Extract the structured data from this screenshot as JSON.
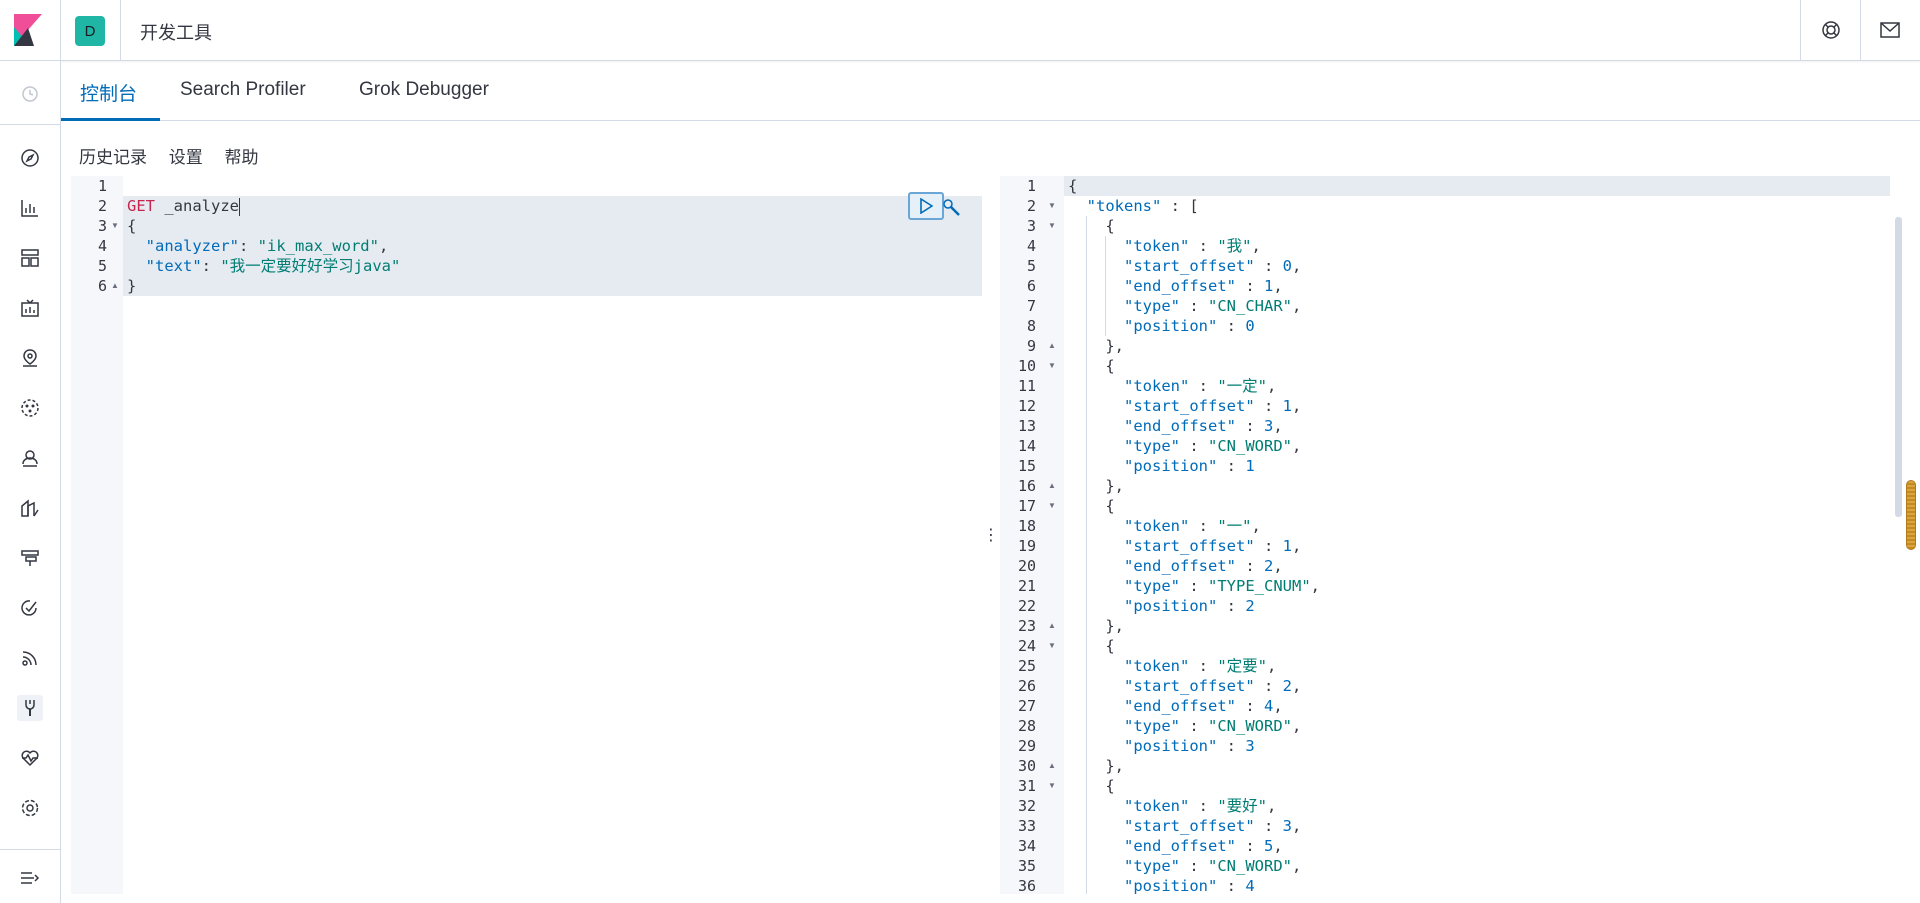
{
  "header": {
    "space_initial": "D",
    "app_title": "开发工具",
    "icons": [
      "kibana-logo-icon",
      "help-icon",
      "mail-icon"
    ]
  },
  "sidenav": {
    "icons": [
      "recent-icon",
      "discover-icon",
      "visualize-icon",
      "dashboard-icon",
      "canvas-icon",
      "maps-icon",
      "ml-icon",
      "infrastructure-icon",
      "logs-icon",
      "apm-icon",
      "uptime-icon",
      "siem-icon",
      "devtools-icon",
      "monitoring-icon",
      "management-icon",
      "collapse-icon"
    ]
  },
  "tabs": [
    {
      "label": "控制台",
      "active": true
    },
    {
      "label": "Search Profiler",
      "active": false
    },
    {
      "label": "Grok Debugger",
      "active": false
    }
  ],
  "menu": {
    "history": "历史记录",
    "settings": "设置",
    "help": "帮助"
  },
  "editor": {
    "line_numbers": [
      "1",
      "2",
      "3",
      "4",
      "5",
      "6"
    ],
    "method": "GET",
    "url": " _analyze",
    "open_brace": "{",
    "close_brace": "}",
    "analyzer_key": "  \"analyzer\"",
    "analyzer_val": "\"ik_max_word\"",
    "text_key": "  \"text\"",
    "text_val": "\"我一定要好好学习java\""
  },
  "output": {
    "line_numbers": [
      "1",
      "2",
      "3",
      "4",
      "5",
      "6",
      "7",
      "8",
      "9",
      "10",
      "11",
      "12",
      "13",
      "14",
      "15",
      "16",
      "17",
      "18",
      "19",
      "20",
      "21",
      "22",
      "23",
      "24",
      "25",
      "26",
      "27",
      "28",
      "29",
      "30",
      "31",
      "32",
      "33",
      "34",
      "35",
      "36"
    ],
    "tokens": [
      {
        "token": "\"我\"",
        "start_offset": "0",
        "end_offset": "1",
        "type": "\"CN_CHAR\"",
        "position": "0"
      },
      {
        "token": "\"一定\"",
        "start_offset": "1",
        "end_offset": "3",
        "type": "\"CN_WORD\"",
        "position": "1"
      },
      {
        "token": "\"一\"",
        "start_offset": "1",
        "end_offset": "2",
        "type": "\"TYPE_CNUM\"",
        "position": "2"
      },
      {
        "token": "\"定要\"",
        "start_offset": "2",
        "end_offset": "4",
        "type": "\"CN_WORD\"",
        "position": "3"
      },
      {
        "token": "\"要好\"",
        "start_offset": "3",
        "end_offset": "5",
        "type": "\"CN_WORD\"",
        "position": "4"
      }
    ],
    "tokens_key": "\"tokens\""
  }
}
